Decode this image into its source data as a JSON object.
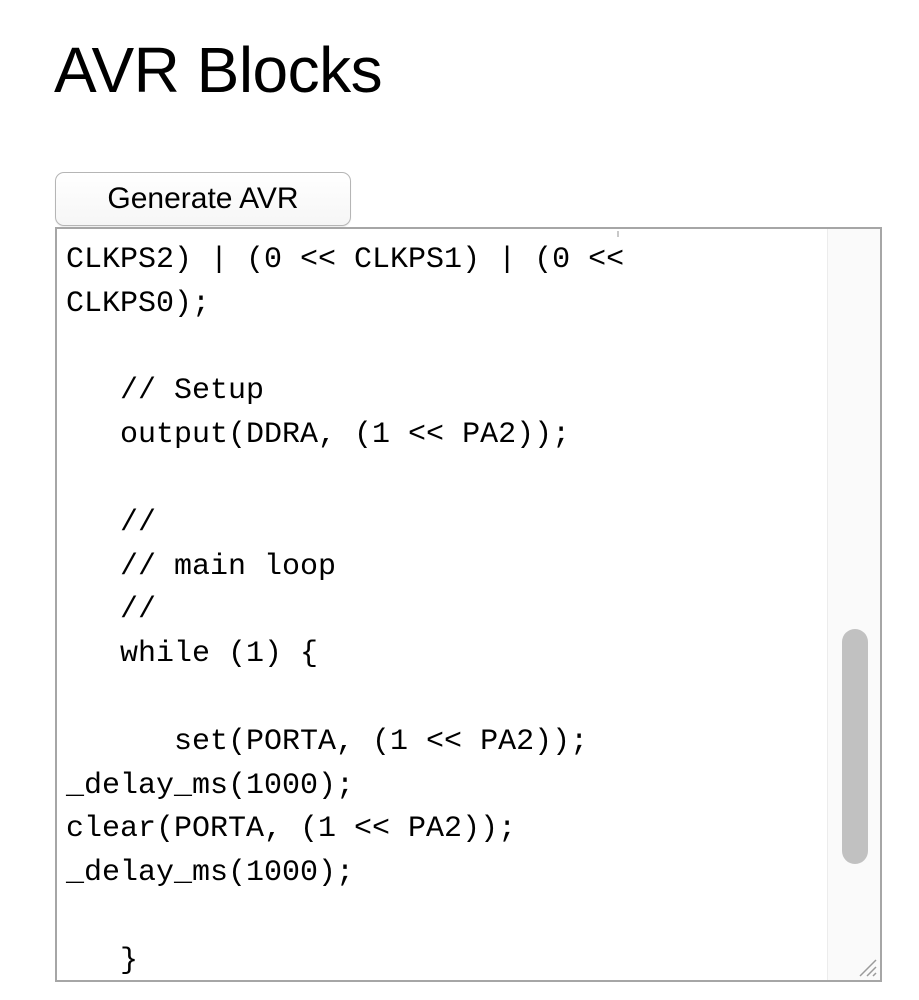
{
  "page": {
    "title": "AVR Blocks"
  },
  "toolbar": {
    "generate_label": "Generate AVR"
  },
  "editor": {
    "lines": [
      "CLKPS2) | (0 << CLKPS1) | (0 <<",
      "CLKPS0);",
      "",
      "   // Setup",
      "   output(DDRA, (1 << PA2));",
      "",
      "   //",
      "   // main loop",
      "   //",
      "   while (1) {",
      "",
      "      set(PORTA, (1 << PA2));",
      "_delay_ms(1000);",
      "clear(PORTA, (1 << PA2));",
      "_delay_ms(1000);",
      "",
      "   }"
    ],
    "scroll_position": 0.86,
    "scroll_visible_fraction": 0.34
  },
  "colors": {
    "text": "#000000",
    "border": "#a6a6a6",
    "scroll_thumb": "#c1c1c1"
  }
}
